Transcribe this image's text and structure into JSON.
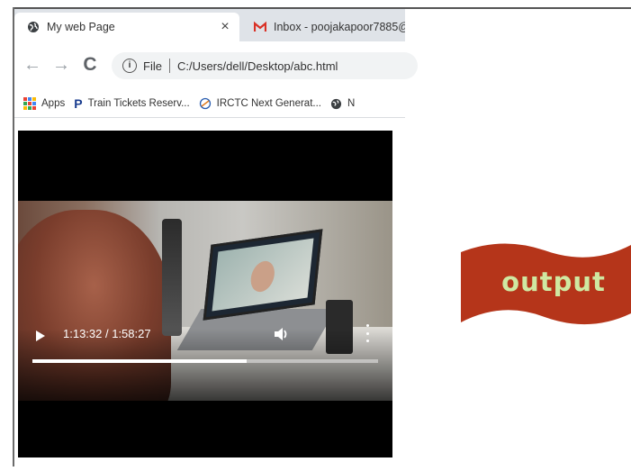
{
  "browser": {
    "tabs": [
      {
        "title": "My web Page",
        "active": true,
        "close_glyph": "×",
        "icon": "globe-icon"
      },
      {
        "title": "Inbox - poojakapoor7885@",
        "active": false,
        "icon": "gmail-icon"
      }
    ],
    "nav": {
      "back_glyph": "←",
      "forward_glyph": "→",
      "reload_glyph": "C"
    },
    "address": {
      "scheme_label": "File",
      "url": "C:/Users/dell/Desktop/abc.html",
      "info_glyph": "i"
    },
    "bookmarks": [
      {
        "label": "Apps",
        "icon": "apps-grid-icon"
      },
      {
        "label": "Train Tickets Reserv...",
        "icon": "p-letter-icon"
      },
      {
        "label": "IRCTC Next Generat...",
        "icon": "irctc-icon"
      },
      {
        "label": "N",
        "icon": "globe-icon"
      }
    ]
  },
  "video": {
    "current_time": "1:13:32",
    "duration": "1:58:27",
    "time_display": "1:13:32 / 1:58:27",
    "progress_fraction": 0.62
  },
  "ribbon": {
    "label": "output"
  },
  "colors": {
    "ribbon": "#b5351a",
    "ribbon_text": "#cfe8a2",
    "gmail_red": "#d93025",
    "tabstrip": "#dfe3e8"
  }
}
